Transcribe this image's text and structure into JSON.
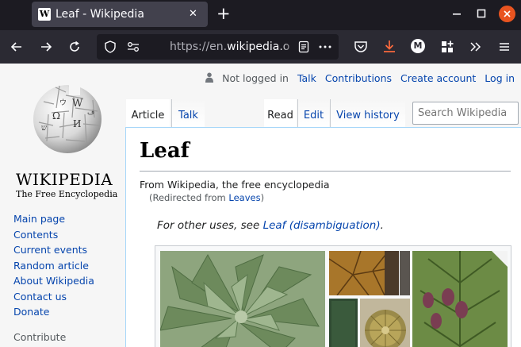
{
  "browser": {
    "tab_title": "Leaf - Wikipedia",
    "tab_favicon": "W",
    "tab_close": "✕",
    "new_tab": "+",
    "url_prefix": "https://en.",
    "url_host": "wikipedia.o",
    "colors": {
      "titlebar": "#1c1b22",
      "toolbar": "#2b2a33",
      "close_button": "#e95420"
    },
    "icons": [
      "back-arrow-icon",
      "forward-arrow-icon",
      "reload-icon",
      "shield-icon",
      "permissions-icon",
      "reader-view-icon",
      "more-actions-icon",
      "pocket-icon",
      "download-icon",
      "account-icon",
      "extensions-icon",
      "overflow-icon",
      "menu-icon"
    ],
    "account_initial": "M"
  },
  "personal_tools": {
    "not_logged_in": "Not logged in",
    "talk": "Talk",
    "contributions": "Contributions",
    "create_account": "Create account",
    "log_in": "Log in"
  },
  "logo": {
    "wordmark": "WIKIPEDIA",
    "tagline": "The Free Encyclopedia"
  },
  "sidebar": {
    "items": [
      {
        "label": "Main page"
      },
      {
        "label": "Contents"
      },
      {
        "label": "Current events"
      },
      {
        "label": "Random article"
      },
      {
        "label": "About Wikipedia"
      },
      {
        "label": "Contact us"
      },
      {
        "label": "Donate"
      }
    ],
    "contribute_heading": "Contribute"
  },
  "page_tabs": {
    "article": "Article",
    "talk": "Talk",
    "read": "Read",
    "edit": "Edit",
    "history": "View history"
  },
  "search": {
    "placeholder": "Search Wikipedia"
  },
  "article": {
    "title": "Leaf",
    "from": "From Wikipedia, the free encyclopedia",
    "redirect_prefix": "(Redirected from ",
    "redirect_link": "Leaves",
    "redirect_suffix": ")",
    "hatnote_prefix": "For other uses, see ",
    "hatnote_link": "Leaf (disambiguation)",
    "hatnote_suffix": "."
  }
}
